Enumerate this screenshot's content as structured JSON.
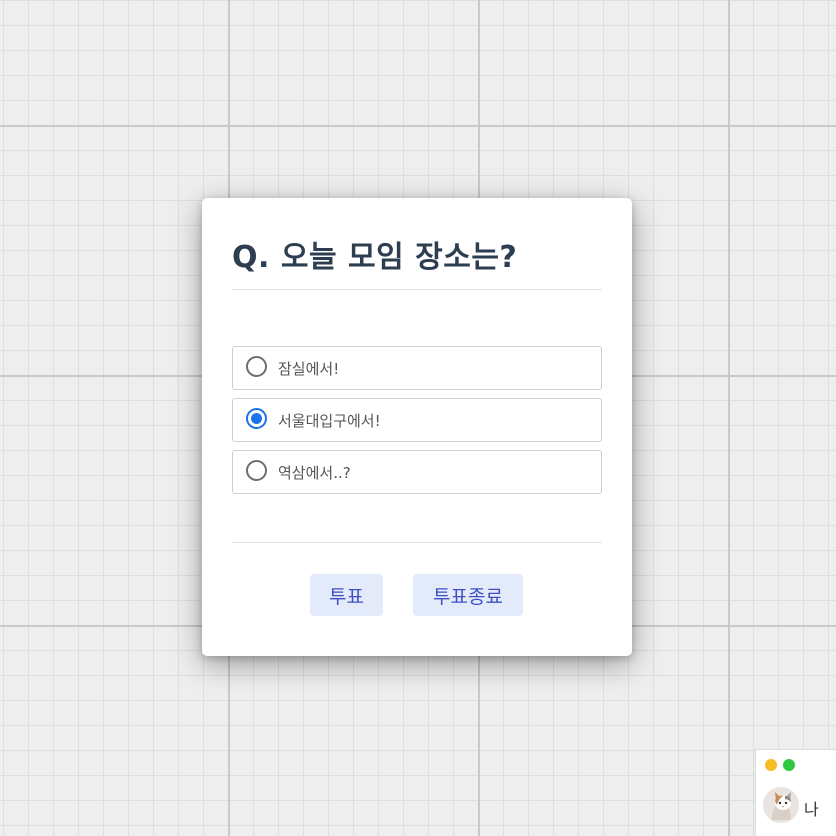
{
  "poll": {
    "question": "Q. 오늘 모임 장소는?",
    "options": [
      {
        "label": "잠실에서!",
        "selected": false
      },
      {
        "label": "서울대입구에서!",
        "selected": true
      },
      {
        "label": "역삼에서..?",
        "selected": false
      }
    ],
    "vote_label": "투표",
    "end_label": "투표종료"
  },
  "presence": {
    "user_label": "나",
    "indicator_colors": [
      "#f5bd20",
      "#2ec840"
    ]
  },
  "colors": {
    "accent": "#1a73e8",
    "button_bg": "#e3ebfb",
    "button_text": "#3f4fc4",
    "title": "#2c3e50"
  }
}
